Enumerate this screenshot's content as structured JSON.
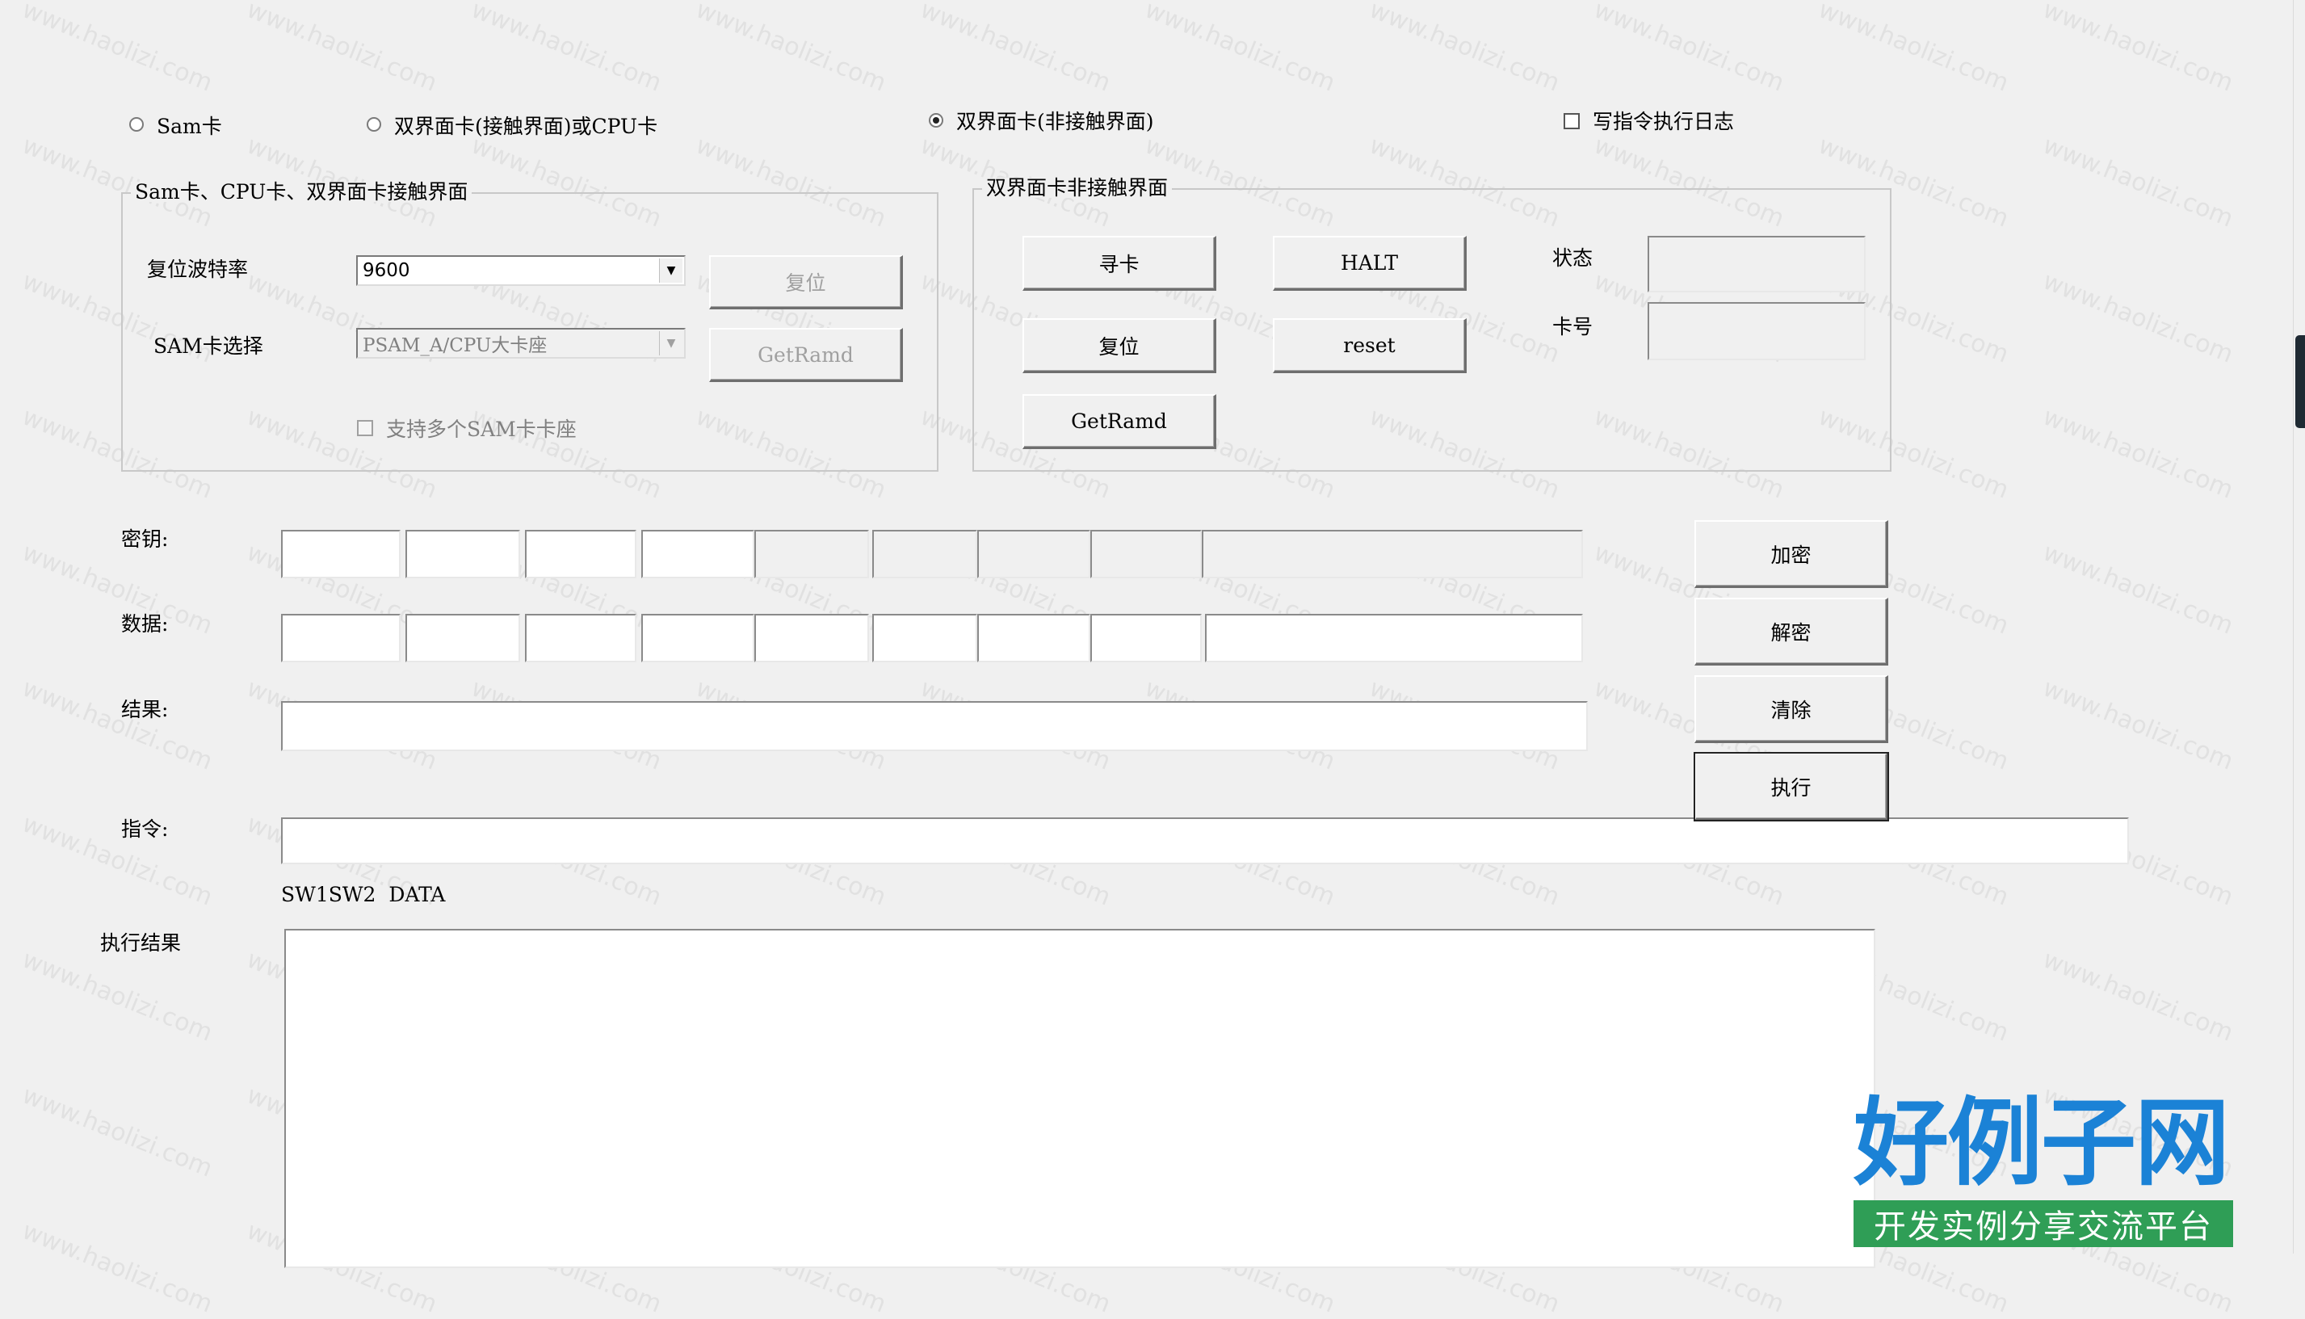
{
  "mode_radios": [
    {
      "label": "Sam卡",
      "selected": false
    },
    {
      "label": "双界面卡(接触界面)或CPU卡",
      "selected": false
    },
    {
      "label": "双界面卡(非接触界面)",
      "selected": true
    }
  ],
  "log_checkbox": {
    "label": "写指令执行日志",
    "checked": false
  },
  "contact_group": {
    "title": "Sam卡、CPU卡、双界面卡接触界面",
    "baud_label": "复位波特率",
    "baud_value": "9600",
    "reset_button": "复位",
    "sam_label": "SAM卡选择",
    "sam_value": "PSAM_A/CPU大卡座",
    "getramd_button": "GetRamd",
    "multi_sam_checkbox": {
      "label": "支持多个SAM卡卡座",
      "checked": false
    }
  },
  "contactless_group": {
    "title": "双界面卡非接触界面",
    "find_card_button": "寻卡",
    "halt_button": "HALT",
    "reset_button": "复位",
    "reset_en_button": "reset",
    "getramd_button": "GetRamd",
    "status_label": "状态",
    "card_no_label": "卡号",
    "status_value": "",
    "card_no_value": ""
  },
  "crypto": {
    "key_label": "密钥:",
    "data_label": "数据:",
    "result_label": "结果:",
    "command_label": "指令:",
    "key_fields": [
      "",
      "",
      "",
      "",
      "",
      "",
      "",
      "",
      ""
    ],
    "data_fields": [
      "",
      "",
      "",
      "",
      "",
      "",
      "",
      "",
      ""
    ],
    "result_value": "",
    "command_value": ""
  },
  "action_buttons": {
    "encrypt": "加密",
    "decrypt": "解密",
    "clear": "清除",
    "execute": "执行"
  },
  "output": {
    "columns_header": "SW1SW2  DATA",
    "label": "执行结果",
    "value": ""
  },
  "watermark_text": "www.haolizi.com",
  "branding": {
    "logo_main": "好例子网",
    "logo_sub": "开发实例分享交流平台"
  }
}
